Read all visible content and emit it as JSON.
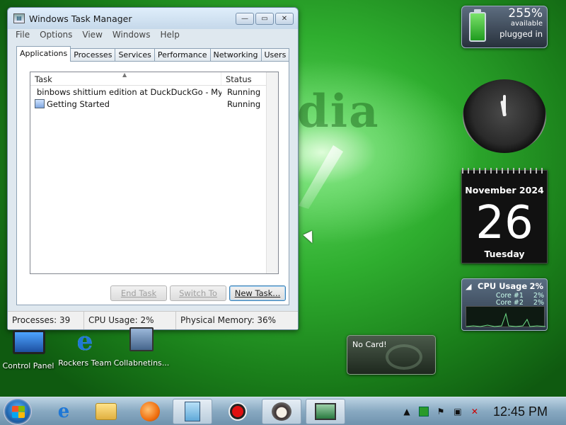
{
  "desktop": {
    "wallpaper_text": "dia",
    "icons": [
      {
        "label": "Control Panel",
        "icon": "monitor-icon"
      },
      {
        "label": "Rockers Team",
        "icon": "internet-explorer-icon"
      },
      {
        "label": "Collabnetins...",
        "icon": "network-computer-icon"
      }
    ]
  },
  "window": {
    "title": "Windows Task Manager",
    "controls": {
      "minimize": "—",
      "maximize": "▭",
      "close": "✕"
    },
    "menu": [
      "File",
      "Options",
      "View",
      "Windows",
      "Help"
    ],
    "tabs": [
      "Applications",
      "Processes",
      "Services",
      "Performance",
      "Networking",
      "Users"
    ],
    "active_tab": "Applications",
    "list": {
      "columns": [
        "Task",
        "Status"
      ],
      "rows": [
        {
          "task": "binbows shittium edition at DuckDuckGo - Mypal",
          "status": "Running",
          "icon": "raccoon-browser-icon"
        },
        {
          "task": "Getting Started",
          "status": "Running",
          "icon": "getting-started-icon"
        }
      ]
    },
    "buttons": {
      "end_task": "End Task",
      "switch_to": "Switch To",
      "new_task": "New Task..."
    },
    "status": {
      "processes": "Processes: 39",
      "cpu": "CPU Usage: 2%",
      "memory": "Physical Memory: 36%"
    }
  },
  "gadgets": {
    "battery": {
      "percent": "255%",
      "available": "available",
      "state": "plugged in"
    },
    "calendar": {
      "month": "November 2024",
      "day": "26",
      "weekday": "Tuesday"
    },
    "cpu": {
      "title": "CPU Usage",
      "total": "2%",
      "cores": [
        {
          "name": "Core #1",
          "value": "2%"
        },
        {
          "name": "Core #2",
          "value": "2%"
        }
      ]
    },
    "video": {
      "text": "No Card!"
    }
  },
  "taskbar": {
    "apps": [
      "internet-explorer-icon",
      "explorer-folder-icon",
      "media-player-icon",
      "task-manager-icon",
      "record-icon",
      "raccoon-browser-icon",
      "network-computer-icon"
    ],
    "time": "12:45 PM"
  },
  "colors": {
    "accent": "#3c7fb1",
    "wallpaper": "#2fae2f"
  }
}
